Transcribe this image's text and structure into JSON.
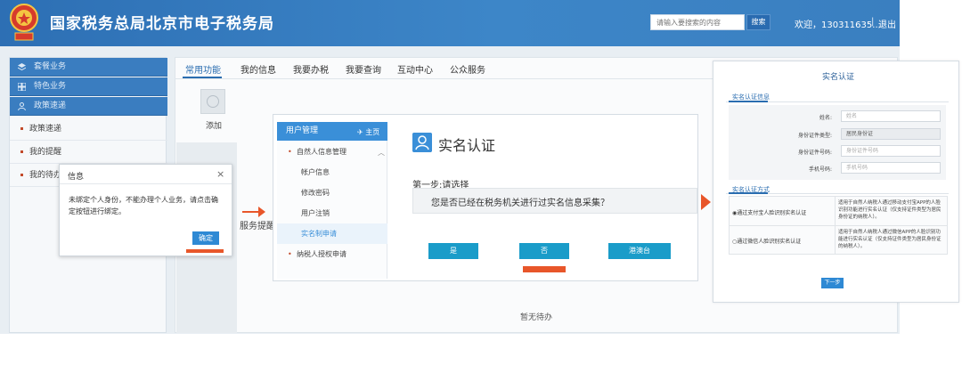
{
  "header": {
    "site_title": "国家税务总局北京市电子税务局",
    "search_placeholder": "请输入要搜索的内容",
    "search_button": "搜索",
    "welcome": "欢迎，130311635...",
    "separator": "|",
    "logout": "退出",
    "colors": {
      "header_bg": "#3a80c2",
      "accent": "#e8562a"
    }
  },
  "sidebar": {
    "items": [
      {
        "label": "套餐业务",
        "icon": "layers-icon"
      },
      {
        "label": "特色业务",
        "icon": "grid-icon"
      },
      {
        "label": "政策速递",
        "icon": "person-icon"
      }
    ],
    "sub_items": [
      "政策速递",
      "我的提醒",
      "我的待办"
    ]
  },
  "tabs": [
    "常用功能",
    "我的信息",
    "我要办税",
    "我要查询",
    "互动中心",
    "公众服务"
  ],
  "main": {
    "add_label": "添加",
    "service_reminder": "服务提醒",
    "empty": "暂无待办"
  },
  "dialog": {
    "title": "信息",
    "close": "×",
    "message": "未绑定个人身份，不能办理个人业务，请点击确定按钮进行绑定。",
    "confirm": "确定"
  },
  "middle": {
    "nav_header": "用户管理",
    "nav_home": "主页",
    "nav_items": [
      {
        "label": "自然人信息管理",
        "type": "parent"
      },
      {
        "label": "帐户信息",
        "type": "child"
      },
      {
        "label": "修改密码",
        "type": "child"
      },
      {
        "label": "用户注销",
        "type": "child"
      },
      {
        "label": "实名制申请",
        "type": "child-active"
      },
      {
        "label": "纳税人授权申请",
        "type": "parent"
      }
    ],
    "title": "实名认证",
    "step": "第一步:请选择",
    "question": "您是否已经在税务机关进行过实名信息采集？",
    "buttons": [
      "是",
      "否",
      "港澳台"
    ]
  },
  "right": {
    "title": "实名认证",
    "section_info": "实名认证信息",
    "fields": [
      {
        "label": "姓名:",
        "value": "姓名",
        "readonly": false
      },
      {
        "label": "身份证件类型:",
        "value": "居民身份证",
        "readonly": true
      },
      {
        "label": "身份证件号码:",
        "value": "身份证件号码",
        "readonly": false
      },
      {
        "label": "手机号码:",
        "value": "手机号码",
        "readonly": false
      }
    ],
    "section_method": "实名认证方式",
    "methods": [
      {
        "label": "通过支付宝人脸识别实名认证",
        "desc": "适用于自然人纳税人通过移动支付宝APP的人脸识别功能进行实名认证（仅支持证件类型为居民身份证的纳税人）。",
        "selected": true
      },
      {
        "label": "通过微信人脸识别实名认证",
        "desc": "适用于自然人纳税人通过微信APP的人脸识别功能进行实名认证（仅支持证件类型为居民身份证的纳税人）。",
        "selected": false
      }
    ],
    "next": "下一步"
  }
}
